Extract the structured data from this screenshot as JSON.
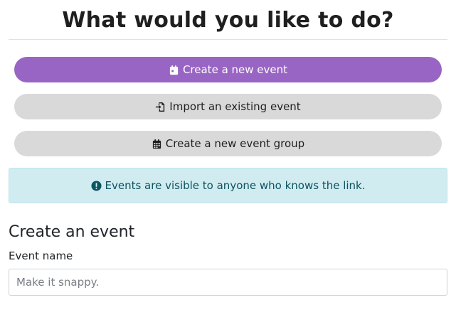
{
  "header": {
    "title": "What would you like to do?"
  },
  "actions": [
    {
      "label": "Create a new event",
      "icon": "calendar-day-icon"
    },
    {
      "label": "Import an existing event",
      "icon": "file-import-icon"
    },
    {
      "label": "Create a new event group",
      "icon": "calendar-grid-icon"
    }
  ],
  "notice": {
    "text": "Events are visible to anyone who knows the link.",
    "icon": "exclamation-circle-icon"
  },
  "form": {
    "title": "Create an event",
    "event_name_label": "Event name",
    "event_name_value": "",
    "event_name_placeholder": "Make it snappy."
  },
  "colors": {
    "primary": "#9965c4",
    "secondary": "#d9d9d9",
    "notice_bg": "#d1ecf1",
    "notice_text": "#0c5460"
  }
}
